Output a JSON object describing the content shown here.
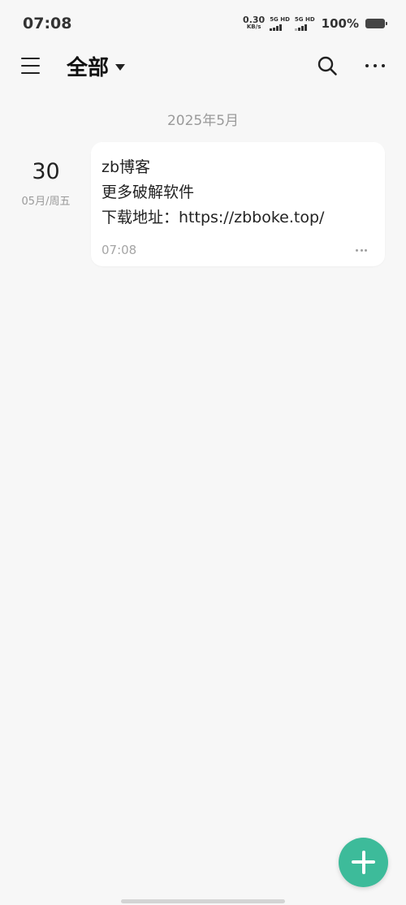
{
  "status_bar": {
    "time": "07:08",
    "net_speed_value": "0.30",
    "net_speed_unit": "KB/s",
    "sim1_label": "5G HD",
    "sim2_label": "5G HD",
    "battery": "100%"
  },
  "header": {
    "menu_icon": "menu-icon",
    "title": "全部",
    "dropdown_icon": "caret-down-icon",
    "search_icon": "search-icon",
    "more_icon": "more-icon"
  },
  "notes_list": {
    "month_header": "2025年5月",
    "groups": [
      {
        "day": "30",
        "date_sub": "05月/周五",
        "note": {
          "lines": [
            "zb博客",
            "更多破解软件",
            "下载地址：https://zbboke.top/"
          ],
          "time": "07:08"
        }
      }
    ]
  },
  "fab": {
    "icon": "plus-icon",
    "color": "#3dbb9a"
  },
  "colors": {
    "background": "#f7f7f7",
    "card": "#ffffff",
    "accent": "#3dbb9a",
    "muted_text": "#9a9a9a"
  }
}
